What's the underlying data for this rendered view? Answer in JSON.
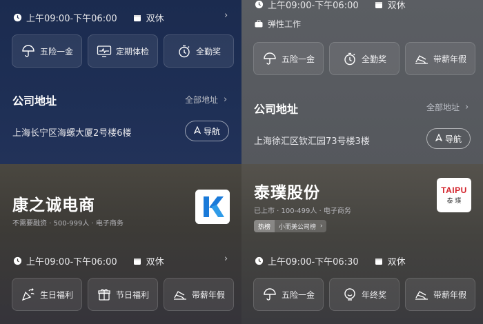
{
  "top_left": {
    "hours": "上午09:00-下午06:00",
    "rest": "双休",
    "benefits": [
      {
        "label": "五险一金",
        "icon": "umbrella-icon"
      },
      {
        "label": "定期体检",
        "icon": "monitor-icon"
      },
      {
        "label": "全勤奖",
        "icon": "stopwatch-icon"
      }
    ],
    "address_title": "公司地址",
    "all_addresses": "全部地址",
    "address": "上海长宁区海螺大厦2号楼6楼",
    "nav_label": "导航"
  },
  "top_right": {
    "hours": "上午09:00-下午06:00",
    "rest": "双休",
    "flex": "弹性工作",
    "benefits": [
      {
        "label": "五险一金",
        "icon": "umbrella-icon"
      },
      {
        "label": "全勤奖",
        "icon": "stopwatch-icon"
      },
      {
        "label": "带薪年假",
        "icon": "beach-chair-icon"
      }
    ],
    "address_title": "公司地址",
    "all_addresses": "全部地址",
    "address": "上海徐汇区钦汇园73号楼3楼",
    "nav_label": "导航"
  },
  "bottom_left": {
    "company": "康之诚电商",
    "meta": "不需要融资 · 500-999人 · 电子商务",
    "hours": "上午09:00-下午06:00",
    "rest": "双休",
    "benefits": [
      {
        "label": "生日福利",
        "icon": "party-icon"
      },
      {
        "label": "节日福利",
        "icon": "gift-icon"
      },
      {
        "label": "带薪年假",
        "icon": "beach-chair-icon"
      }
    ]
  },
  "bottom_right": {
    "company": "泰璞股份",
    "meta": "已上市 · 100-499人 · 电子商务",
    "tag_hot": "热榜",
    "tag_text": "小而美公司榜",
    "logo_text_top": "TAIPU",
    "logo_text_bottom": "泰 璞",
    "hours": "上午09:00-下午06:30",
    "rest": "双休",
    "benefits": [
      {
        "label": "五险一金",
        "icon": "umbrella-icon"
      },
      {
        "label": "年终奖",
        "icon": "smile-icon"
      },
      {
        "label": "带薪年假",
        "icon": "beach-chair-icon"
      }
    ]
  }
}
